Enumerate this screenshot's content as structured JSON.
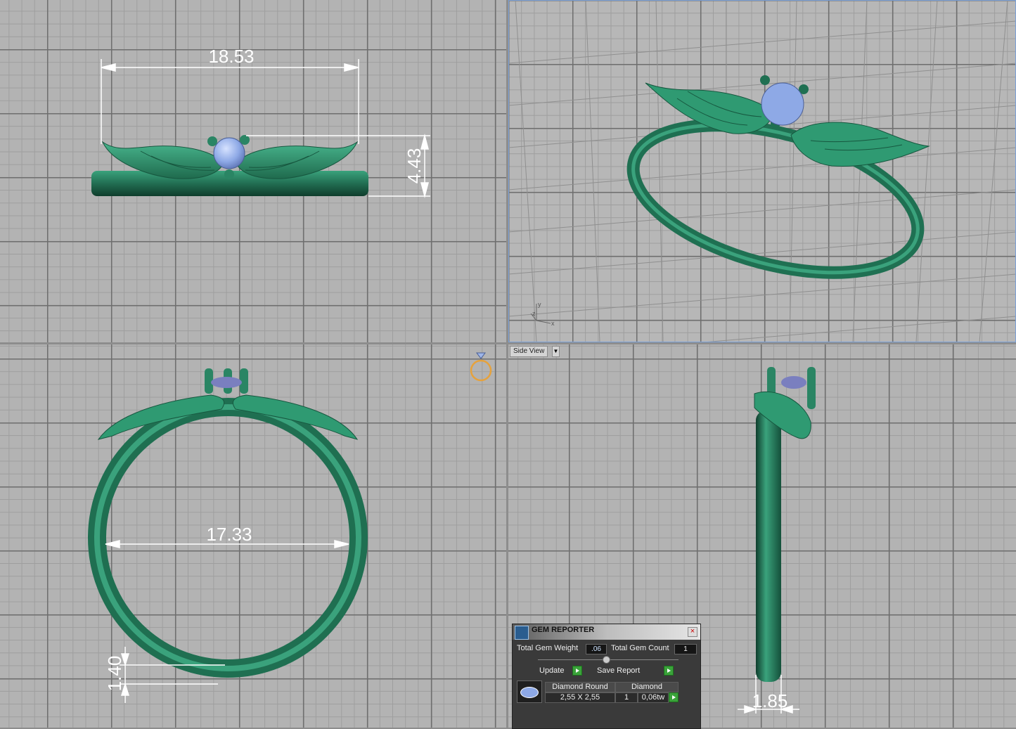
{
  "viewports": {
    "front": {
      "dimensions": {
        "width": "18.53",
        "height": "4.43"
      }
    },
    "top": {
      "dimensions": {
        "inner_diameter": "17.33",
        "thickness": "1.40"
      }
    },
    "side": {
      "view_label": "Side View",
      "dimensions": {
        "width": "1.85"
      }
    },
    "perspective": {
      "axis_x": "x",
      "axis_y": "y",
      "axis_z": "z"
    }
  },
  "colors": {
    "metal": "#2b8a68",
    "gem": "#8ea9e6",
    "dimension_line": "#ffffff",
    "grid_major": "#6e6e6e",
    "grid_minor": "#9e9e9e",
    "viewport_bg": "#b3b3b3"
  },
  "gem_reporter": {
    "title": "GEM REPORTER",
    "total_weight_label": "Total Gem Weight",
    "total_weight_value": ".06",
    "total_count_label": "Total Gem Count",
    "total_count_value": "1",
    "update_label": "Update",
    "save_report_label": "Save Report",
    "table": {
      "col1_header": "Diamond Round",
      "col2_header": "Diamond",
      "size": "2,55 X 2,55",
      "count": "1",
      "weight": "0,06tw"
    }
  }
}
